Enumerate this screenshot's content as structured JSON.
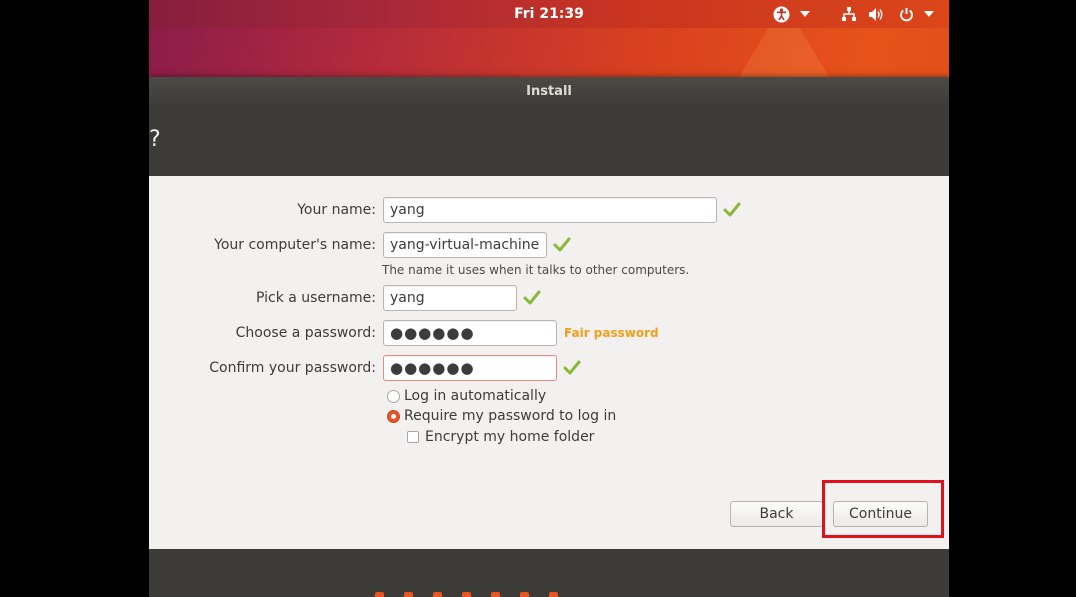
{
  "topbar": {
    "clock": "Fri 21:39",
    "icons": [
      "accessibility-icon",
      "dropdown-arrow-icon",
      "network-icon",
      "volume-icon",
      "power-icon",
      "dropdown-arrow-icon"
    ]
  },
  "window": {
    "title": "Install",
    "heading": "?"
  },
  "form": {
    "your_name_label": "Your name:",
    "your_name_value": "yang",
    "computer_name_label": "Your computer's name:",
    "computer_name_value": "yang-virtual-machine",
    "computer_name_hint": "The name it uses when it talks to other computers.",
    "username_label": "Pick a username:",
    "username_value": "yang",
    "password_label": "Choose a password:",
    "password_value": "●●●●●●",
    "password_strength": "Fair password",
    "confirm_label": "Confirm your password:",
    "confirm_value": "●●●●●●",
    "option_auto_login": "Log in automatically",
    "option_require_password": "Require my password to log in",
    "option_encrypt_home": "Encrypt my home folder",
    "selected_option": "Require my password to log in",
    "encrypt_checked": false
  },
  "buttons": {
    "back": "Back",
    "continue": "Continue"
  },
  "colors": {
    "accent": "#e95420",
    "valid_check": "#8ab83a",
    "strength_fair": "#f29e1b",
    "highlight_box": "#e0101d",
    "window_dark": "#3c3b37"
  }
}
